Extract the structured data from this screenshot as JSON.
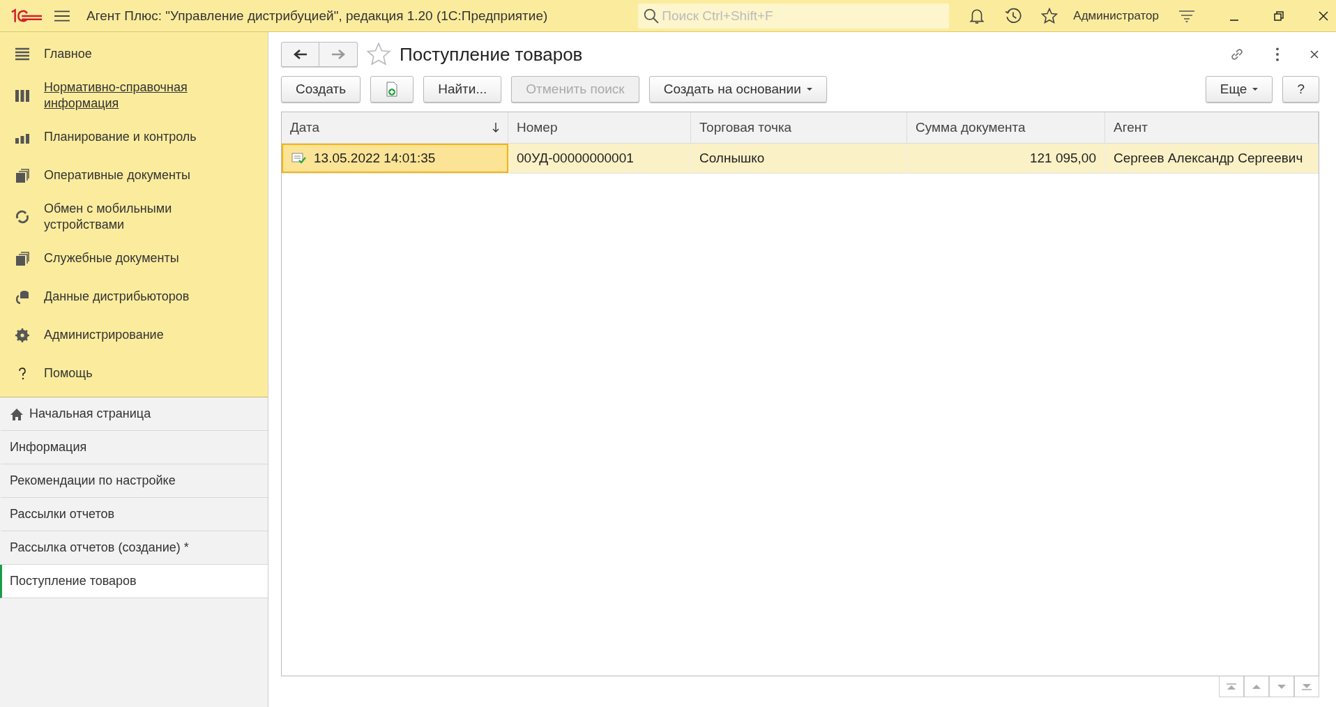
{
  "app_bar": {
    "title": "Агент Плюс: \"Управление дистрибуцией\", редакция 1.20  (1С:Предприятие)",
    "search": {
      "placeholder": "Поиск Ctrl+Shift+F"
    },
    "user": "Администратор"
  },
  "sections": [
    {
      "label": "Главное",
      "hovered": false
    },
    {
      "label": "Нормативно-справочная информация",
      "hovered": true
    },
    {
      "label": "Планирование и контроль",
      "hovered": false
    },
    {
      "label": "Оперативные документы",
      "hovered": false
    },
    {
      "label": "Обмен с мобильными устройствами",
      "hovered": false
    },
    {
      "label": "Служебные документы",
      "hovered": false
    },
    {
      "label": "Данные дистрибьюторов",
      "hovered": false
    },
    {
      "label": "Администрирование",
      "hovered": false
    },
    {
      "label": "Помощь",
      "hovered": false
    }
  ],
  "open_windows": [
    {
      "label": "Начальная страница",
      "kind": "home",
      "selected": false
    },
    {
      "label": "Информация",
      "kind": "page",
      "selected": false
    },
    {
      "label": "Рекомендации по настройке",
      "kind": "page",
      "selected": false
    },
    {
      "label": "Рассылки отчетов",
      "kind": "page",
      "selected": false
    },
    {
      "label": "Рассылка отчетов (создание) *",
      "kind": "page",
      "selected": false
    },
    {
      "label": "Поступление товаров",
      "kind": "page",
      "selected": true
    }
  ],
  "form": {
    "title": "Поступление товаров",
    "favorite": false,
    "toolbar": [
      {
        "kind": "text",
        "label": "Создать",
        "disabled": false,
        "dropdown": false
      },
      {
        "kind": "icon",
        "disabled": false,
        "dropdown": false
      },
      {
        "kind": "text",
        "label": "Найти...",
        "disabled": false,
        "dropdown": false
      },
      {
        "kind": "text",
        "label": "Отменить поиск",
        "disabled": true,
        "dropdown": false
      },
      {
        "kind": "text",
        "label": "Создать на основании",
        "disabled": false,
        "dropdown": true
      }
    ],
    "toolbar_right": [
      {
        "label": "Еще",
        "dropdown": true
      },
      {
        "label": "?",
        "dropdown": false
      }
    ],
    "table": {
      "columns": [
        {
          "label": "Дата",
          "kind": "text",
          "sorted": true
        },
        {
          "label": "Номер",
          "kind": "text",
          "sorted": false
        },
        {
          "label": "Торговая точка",
          "kind": "text",
          "sorted": false
        },
        {
          "label": "Сумма документа",
          "kind": "number",
          "sorted": false
        },
        {
          "label": "Агент",
          "kind": "text",
          "sorted": false
        }
      ],
      "rows": [
        {
          "selected": true,
          "posted": true,
          "cells": [
            {
              "text": "13.05.2022 14:01:35",
              "focused": true
            },
            {
              "text": "00УД-00000000001",
              "focused": false
            },
            {
              "text": "Солнышко",
              "focused": false
            },
            {
              "text": "121 095,00",
              "focused": false
            },
            {
              "text": "Сергеев Александр Сергеевич",
              "focused": false
            }
          ]
        }
      ]
    }
  }
}
